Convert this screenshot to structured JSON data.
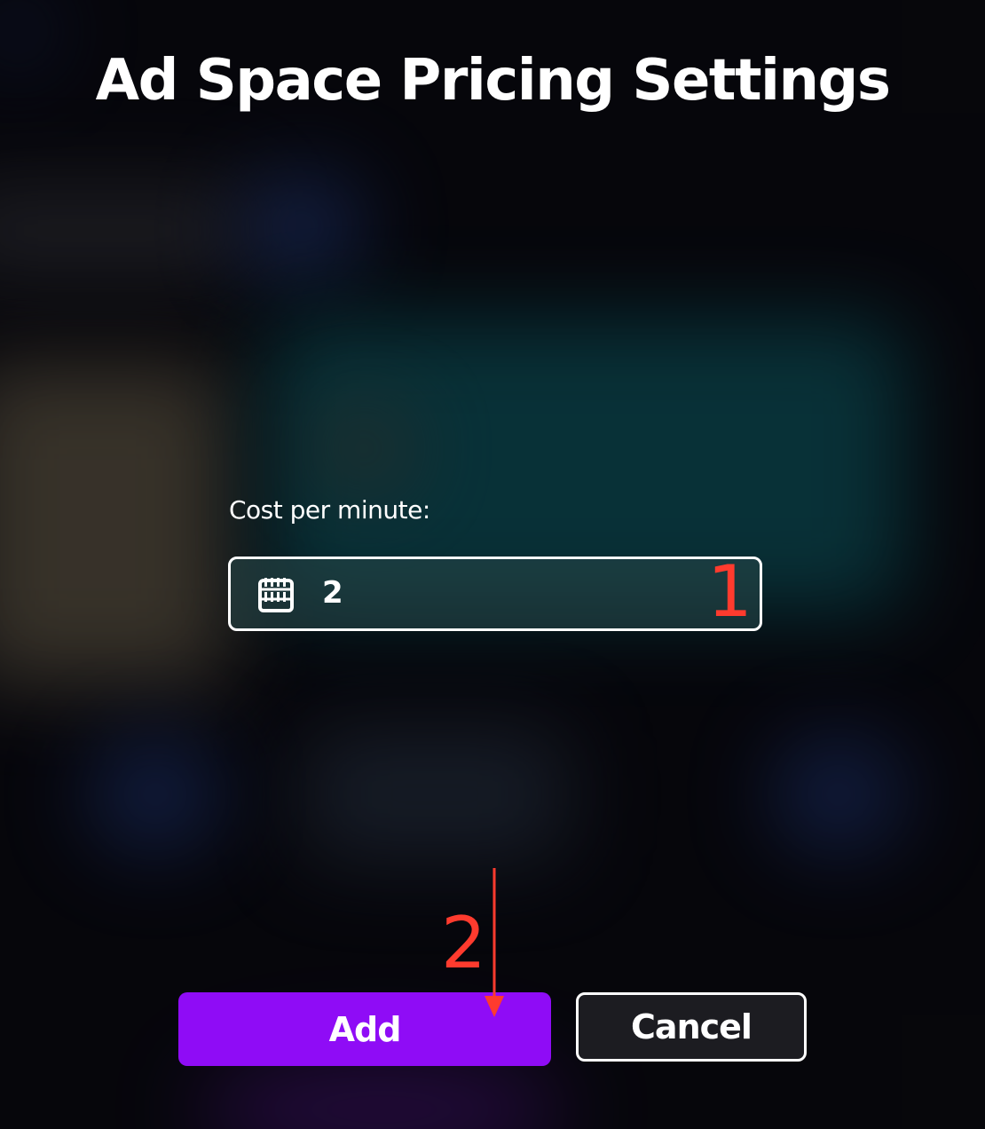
{
  "dialog": {
    "title": "Ad Space Pricing Settings"
  },
  "form": {
    "cost_label": "Cost per minute:",
    "cost_value": "2",
    "cost_icon": "abacus-icon"
  },
  "annotations": {
    "step_1": "1",
    "step_2": "2",
    "color": "#ff3b2e"
  },
  "buttons": {
    "add_label": "Add",
    "cancel_label": "Cancel"
  },
  "colors": {
    "primary": "#8f0cf6",
    "cancel_bg": "#1c1c21",
    "text": "#ffffff"
  }
}
